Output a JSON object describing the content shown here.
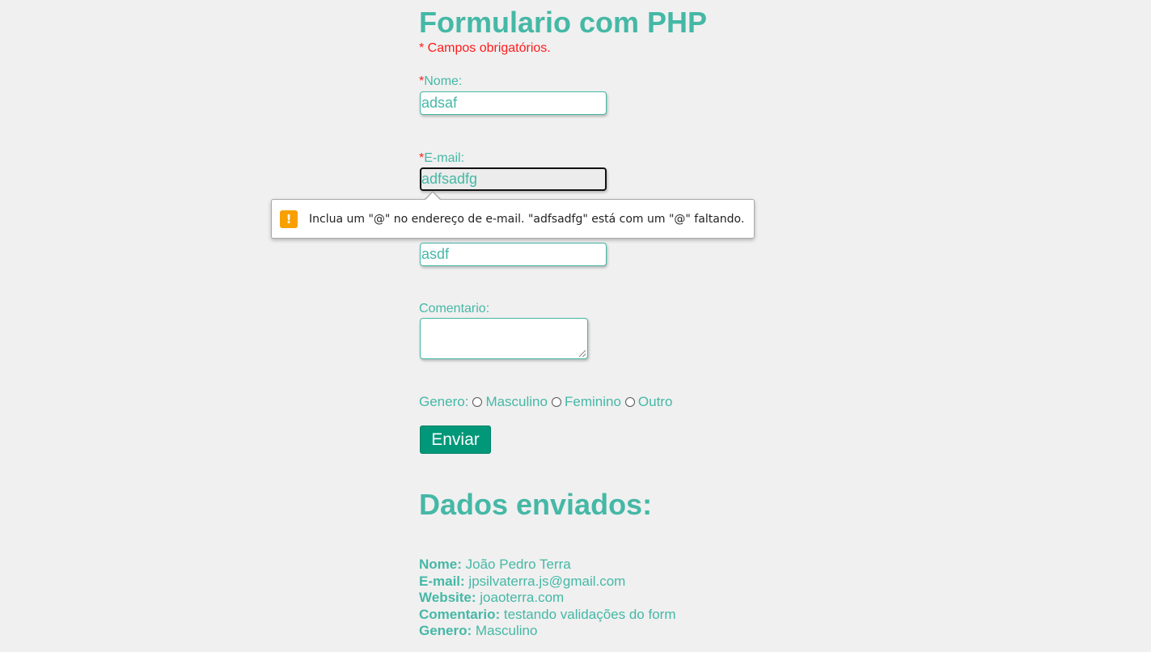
{
  "form": {
    "title": "Formulario com PHP",
    "required_note": "* Campos obrigatórios.",
    "star": "*",
    "name_label": "Nome:",
    "name_value": "adsaf",
    "email_label": "E-mail:",
    "email_value": "adfsadfg",
    "website_value": "asdf",
    "comment_label": "Comentario:",
    "comment_value": "",
    "gender_label": "Genero:",
    "gender_options": [
      "Masculino",
      "Feminino",
      "Outro"
    ],
    "submit_label": "Enviar"
  },
  "validation_tooltip": {
    "icon": "warning-icon",
    "message": "Inclua um \"@\" no endereço de e-mail. \"adfsadfg\" está com um \"@\" faltando."
  },
  "results": {
    "title": "Dados enviados:",
    "rows": [
      {
        "label": "Nome:",
        "value": "João Pedro Terra"
      },
      {
        "label": "E-mail:",
        "value": "jpsilvaterra.js@gmail.com"
      },
      {
        "label": "Website:",
        "value": "joaoterra.com"
      },
      {
        "label": "Comentario:",
        "value": "testando validações do form"
      },
      {
        "label": "Genero:",
        "value": "Masculino"
      }
    ]
  },
  "colors": {
    "accent": "#45b8a6",
    "required": "#ff1a1a",
    "button": "#009879",
    "warning": "#f8a000",
    "background": "#f0f0f0"
  }
}
